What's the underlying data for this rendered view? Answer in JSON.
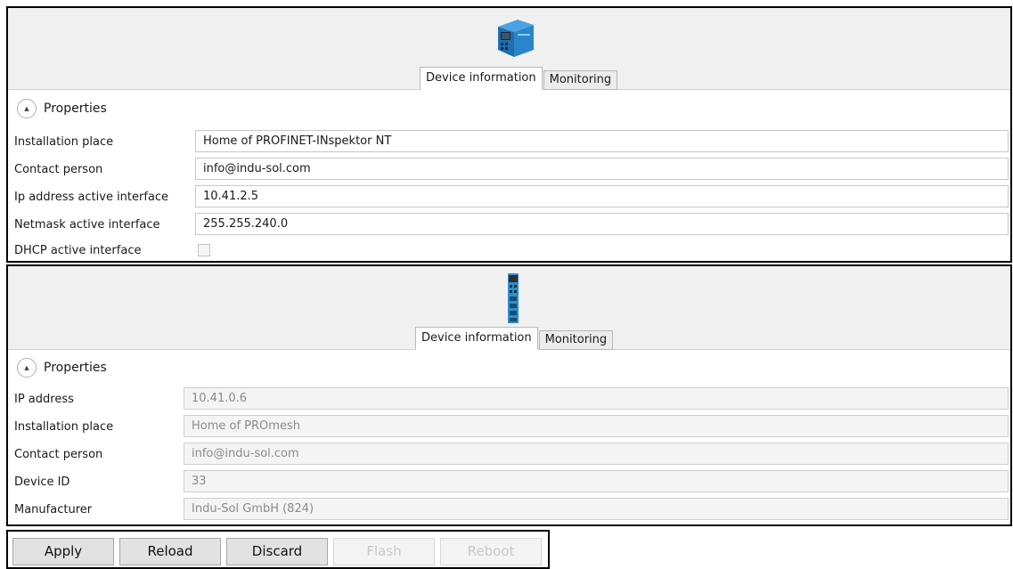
{
  "panel1": {
    "device_icon": "inspektor-nt-device-icon",
    "tabs": [
      {
        "label": "Device information",
        "active": true
      },
      {
        "label": "Monitoring",
        "active": false
      }
    ],
    "section_label": "Properties",
    "rows": [
      {
        "label": "Installation place",
        "value": "Home of PROFINET-INspektor NT"
      },
      {
        "label": "Contact person",
        "value": "info@indu-sol.com"
      },
      {
        "label": "Ip address active interface",
        "value": "10.41.2.5"
      },
      {
        "label": "Netmask active interface",
        "value": "255.255.240.0"
      }
    ],
    "dhcp": {
      "label": "DHCP active interface",
      "checked": false,
      "enabled": false
    }
  },
  "panel2": {
    "device_icon": "promesh-switch-icon",
    "tabs": [
      {
        "label": "Device information",
        "active": true
      },
      {
        "label": "Monitoring",
        "active": false
      }
    ],
    "section_label": "Properties",
    "rows": [
      {
        "label": "IP address",
        "value": "10.41.0.6"
      },
      {
        "label": "Installation place",
        "value": "Home of PROmesh"
      },
      {
        "label": "Contact person",
        "value": "info@indu-sol.com"
      },
      {
        "label": "Device ID",
        "value": "33"
      },
      {
        "label": "Manufacturer",
        "value": "Indu-Sol GmbH (824)"
      }
    ]
  },
  "toolbar": {
    "buttons": [
      {
        "label": "Apply",
        "enabled": true
      },
      {
        "label": "Reload",
        "enabled": true
      },
      {
        "label": "Discard",
        "enabled": true
      },
      {
        "label": "Flash",
        "enabled": false
      },
      {
        "label": "Reboot",
        "enabled": false
      }
    ]
  }
}
